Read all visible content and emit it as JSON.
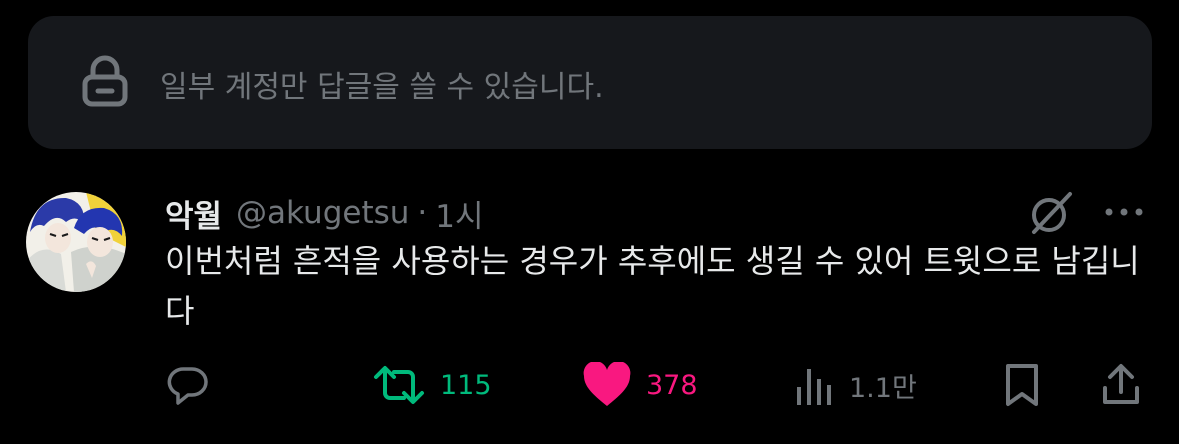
{
  "reply_restriction": {
    "icon": "lock-icon",
    "text": "일부 계정만 답글을 쓸 수 있습니다."
  },
  "tweet": {
    "author_name": "악월",
    "handle": "@akugetsu",
    "separator": "·",
    "time": "1시",
    "text": "이번처럼 흔적을 사용하는 경우가 추후에도 생길 수 있어 트윗으로 남깁니다"
  },
  "actions": {
    "reply": {
      "icon": "reply-icon",
      "count": ""
    },
    "retweet": {
      "icon": "retweet-icon",
      "count": "115",
      "color": "#00ba7c"
    },
    "like": {
      "icon": "heart-icon",
      "count": "378",
      "color": "#f91880"
    },
    "views": {
      "icon": "views-icon",
      "count": "1.1만"
    },
    "bookmark": {
      "icon": "bookmark-icon"
    },
    "share": {
      "icon": "share-icon"
    }
  },
  "colors": {
    "background": "#000000",
    "banner": "#16181c",
    "secondary_text": "#71767b",
    "primary_text": "#e7e9ea"
  }
}
